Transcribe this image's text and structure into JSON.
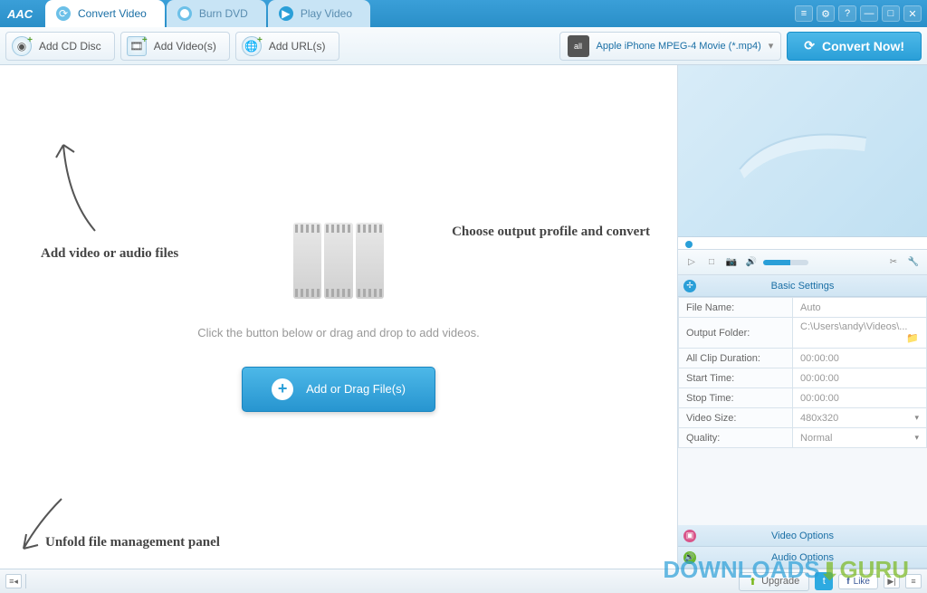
{
  "app": {
    "logo": "AAC"
  },
  "tabs": {
    "convert": "Convert Video",
    "burn": "Burn DVD",
    "play": "Play Video"
  },
  "toolbar": {
    "add_cd": "Add CD Disc",
    "add_videos": "Add Video(s)",
    "add_urls": "Add URL(s)",
    "profile_icon": "all",
    "profile_label": "Apple iPhone MPEG-4 Movie (*.mp4)",
    "convert": "Convert Now!"
  },
  "drop": {
    "hint": "Click the button below or drag and drop to add videos.",
    "button": "Add or Drag File(s)"
  },
  "annotations": {
    "add_files": "Add video or audio files",
    "choose_profile": "Choose output profile and convert",
    "unfold": "Unfold file management panel"
  },
  "sections": {
    "basic": "Basic Settings",
    "video_opts": "Video Options",
    "audio_opts": "Audio Options"
  },
  "settings": {
    "file_name_label": "File Name:",
    "file_name_value": "Auto",
    "output_folder_label": "Output Folder:",
    "output_folder_value": "C:\\Users\\andy\\Videos\\...",
    "clip_dur_label": "All Clip Duration:",
    "clip_dur_value": "00:00:00",
    "start_label": "Start Time:",
    "start_value": "00:00:00",
    "stop_label": "Stop Time:",
    "stop_value": "00:00:00",
    "videosize_label": "Video Size:",
    "videosize_value": "480x320",
    "quality_label": "Quality:",
    "quality_value": "Normal"
  },
  "statusbar": {
    "upgrade": "Upgrade",
    "like": "Like"
  },
  "watermark": {
    "downloads": "DOWNLOADS",
    "guru": "GURU"
  }
}
